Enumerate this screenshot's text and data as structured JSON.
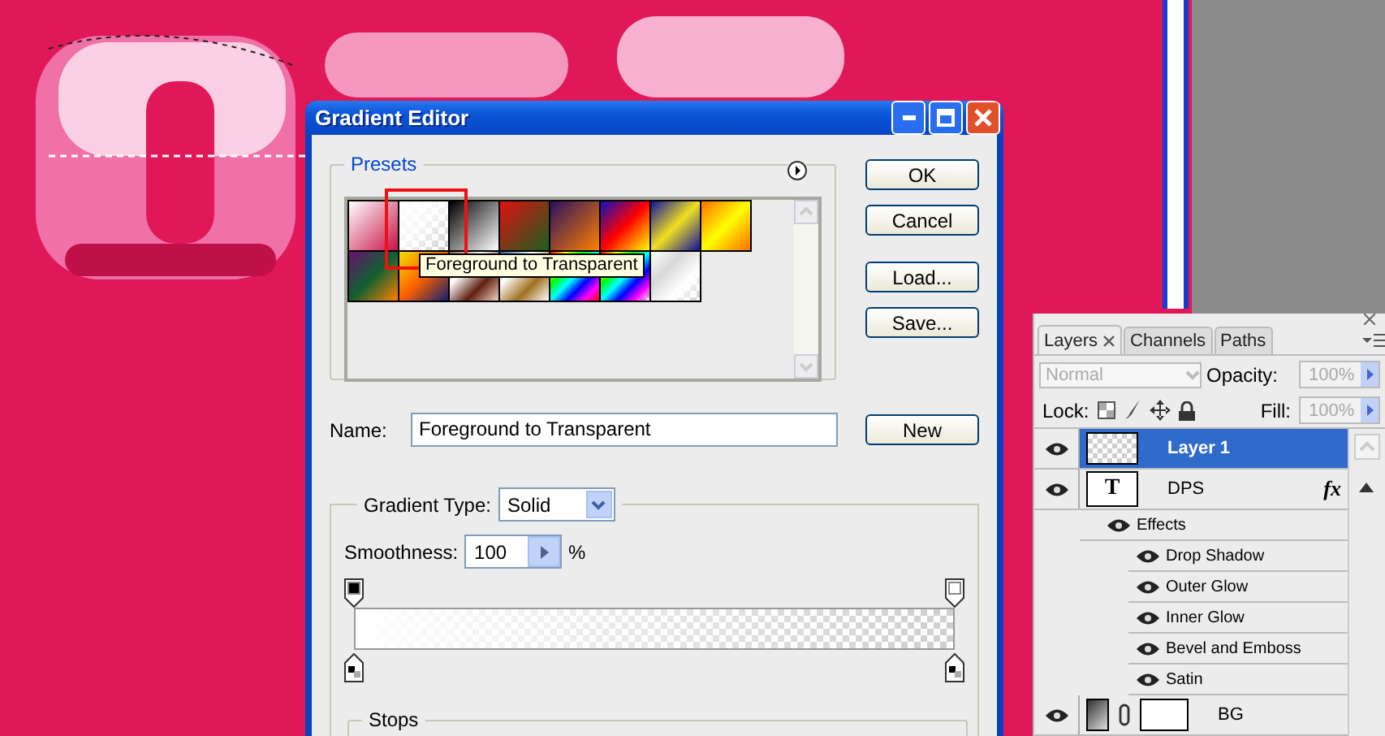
{
  "dialog": {
    "title": "Gradient Editor",
    "presets_label": "Presets",
    "tooltip": "Foreground to Transparent",
    "buttons": [
      "OK",
      "Cancel",
      "Load...",
      "Save..."
    ],
    "name_label": "Name:",
    "name_value": "Foreground to Transparent",
    "new_button": "New",
    "gradient_type_label": "Gradient Type:",
    "gradient_type": "Solid",
    "smoothness_label": "Smoothness:",
    "smoothness": "100",
    "percent": "%",
    "opacity_stops": [
      {
        "level": 0,
        "opaque": true
      },
      {
        "level": 1,
        "opaque": false
      }
    ],
    "color_stops": [
      {
        "level": 0
      },
      {
        "level": 1
      }
    ],
    "stops_label": "Stops"
  },
  "layers_panel": {
    "tabs": [
      {
        "label": "Layers",
        "selected": true,
        "closable": true
      },
      {
        "label": "Channels",
        "selected": false,
        "closable": false
      },
      {
        "label": "Paths",
        "selected": false,
        "closable": false
      }
    ],
    "blend_mode": "Normal",
    "opacity_label": "Opacity:",
    "opacity": "100%",
    "lock_label": "Lock:",
    "fill_label": "Fill:",
    "fill": "100%",
    "layers": [
      {
        "kind": "pixel",
        "name": "Layer 1",
        "selected": true,
        "visible": true
      },
      {
        "kind": "text",
        "name": "DPS",
        "thumb": "T",
        "fx": "fx",
        "selected": false,
        "visible": true,
        "effects_label": "Effects",
        "effects": [
          {
            "name": "Drop Shadow",
            "visible": true
          },
          {
            "name": "Outer Glow",
            "visible": true
          },
          {
            "name": "Inner Glow",
            "visible": true
          },
          {
            "name": "Bevel and Emboss",
            "visible": true
          },
          {
            "name": "Satin",
            "visible": true
          }
        ]
      },
      {
        "kind": "fill",
        "name": "BG",
        "selected": false,
        "visible": true
      }
    ]
  }
}
